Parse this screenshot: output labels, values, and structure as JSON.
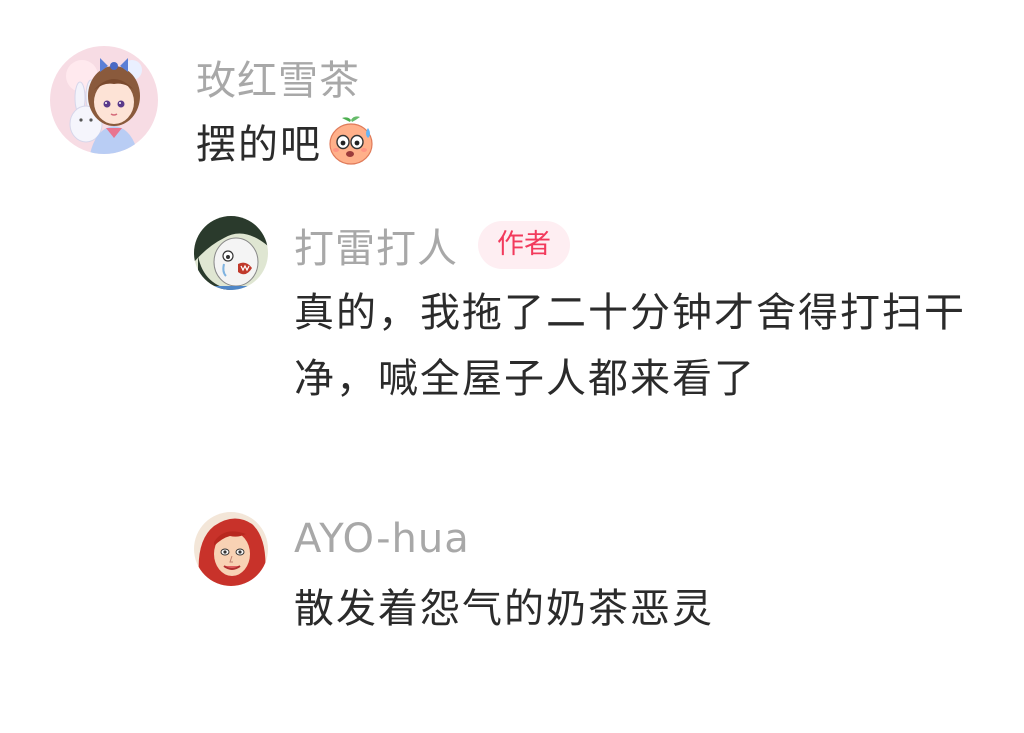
{
  "comments": [
    {
      "username": "玫红雪茶",
      "text": "摆的吧",
      "emoji": "sweating-peach-face-emoji",
      "avatar": "anime-girl-with-bunny-avatar"
    },
    {
      "username": "打雷打人",
      "tag": "作者",
      "text_line1": "真的，我拖了二十分钟才舍得打扫干",
      "text_line2": "净，喊全屋子人都来看了",
      "avatar": "crying-cartoon-character-avatar"
    },
    {
      "username": "AYO-hua",
      "text": "散发着怨气的奶茶恶灵",
      "avatar": "red-haired-girl-avatar"
    }
  ],
  "colors": {
    "username": "#a8a8a8",
    "text": "#2b2b2b",
    "author_tag_bg": "#feeef2",
    "author_tag_text": "#f23a5c"
  }
}
